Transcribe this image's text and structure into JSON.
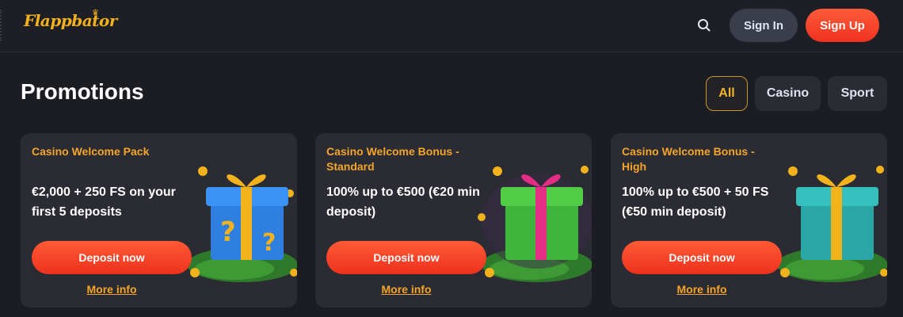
{
  "header": {
    "logo_text": "Flappbator",
    "search_icon": "search-icon",
    "signin_label": "Sign In",
    "signup_label": "Sign Up"
  },
  "page": {
    "title": "Promotions",
    "filters": [
      {
        "label": "All",
        "active": true
      },
      {
        "label": "Casino",
        "active": false
      },
      {
        "label": "Sport",
        "active": false
      }
    ]
  },
  "promotions": [
    {
      "title": "Casino Welcome Pack",
      "description": "€2,000 + 250 FS on your first 5 deposits",
      "button_label": "Deposit now",
      "link_label": "More info",
      "gift_color": "#2f7fe0"
    },
    {
      "title": "Casino Welcome Bonus - Standard",
      "description": "100% up to €500 (€20 min deposit)",
      "button_label": "Deposit now",
      "link_label": "More info",
      "gift_color": "#3fb43a"
    },
    {
      "title": "Casino Welcome Bonus - High",
      "description": "100% up to €500 + 50 FS (€50 min deposit)",
      "button_label": "Deposit now",
      "link_label": "More info",
      "gift_color": "#2aa6a6"
    }
  ],
  "colors": {
    "accent": "#f4a52a",
    "cta": "#f0321f",
    "background": "#1c1d23",
    "card": "#2a2b33"
  }
}
